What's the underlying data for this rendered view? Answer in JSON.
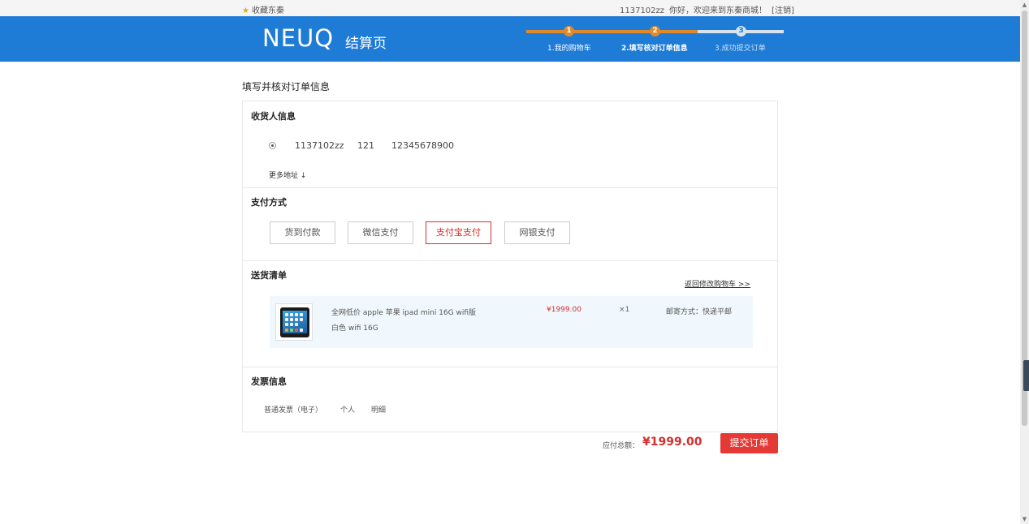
{
  "topbar": {
    "favorite_label": "收藏东秦",
    "username": "1137102zz",
    "greeting": "你好，欢迎来到东秦商城！",
    "logout": "[注销]"
  },
  "header": {
    "logo": "NEUQ",
    "subtitle": "结算页",
    "steps": [
      {
        "num": "1",
        "label": "1.我的购物车"
      },
      {
        "num": "2",
        "label": "2.填写核对订单信息"
      },
      {
        "num": "3",
        "label": "3.成功提交订单"
      }
    ],
    "current_step": 2
  },
  "main": {
    "title": "填写并核对订单信息",
    "receiver": {
      "title": "收货人信息",
      "name": "1137102zz",
      "address": "121",
      "phone": "12345678900",
      "more": "更多地址 ↓"
    },
    "payment": {
      "title": "支付方式",
      "options": [
        "货到付款",
        "微信支付",
        "支付宝支付",
        "网银支付"
      ],
      "selected": "支付宝支付"
    },
    "delivery": {
      "title": "送货清单",
      "back_link": "返回修改购物车 >>",
      "item": {
        "name_line1": "全网低价 apple 苹果 ipad mini 16G wifi版",
        "name_line2": "白色 wifi 16G",
        "price": "¥1999.00",
        "qty": "×1",
        "shipping": "邮寄方式：快递平邮"
      }
    },
    "invoice": {
      "title": "发票信息",
      "type": "普通发票（电子）",
      "header": "个人",
      "content": "明细"
    }
  },
  "footer": {
    "total_label": "应付总额：",
    "total_value": "¥1999.00",
    "submit_label": "提交订单"
  },
  "colors": {
    "header_bg": "#1e7bd6",
    "step_done": "#e08a2c",
    "accent_red": "#e53935"
  }
}
